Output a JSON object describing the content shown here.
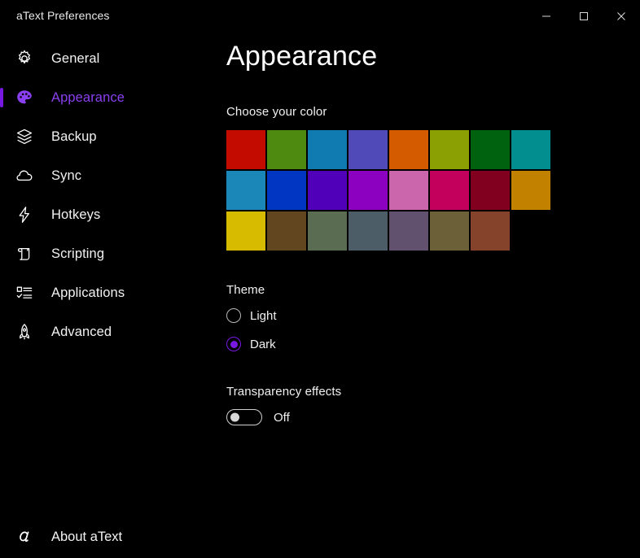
{
  "window": {
    "title": "aText Preferences",
    "controls": [
      {
        "name": "minimize",
        "label": "Minimize"
      },
      {
        "name": "maximize",
        "label": "Maximize"
      },
      {
        "name": "close",
        "label": "Close"
      }
    ]
  },
  "accent_color": "#7719e0",
  "sidebar": {
    "items": [
      {
        "label": "General",
        "icon": "gear-icon",
        "selected": false
      },
      {
        "label": "Appearance",
        "icon": "palette-icon",
        "selected": true
      },
      {
        "label": "Backup",
        "icon": "layers-icon",
        "selected": false
      },
      {
        "label": "Sync",
        "icon": "cloud-icon",
        "selected": false
      },
      {
        "label": "Hotkeys",
        "icon": "lightning-icon",
        "selected": false
      },
      {
        "label": "Scripting",
        "icon": "scroll-icon",
        "selected": false
      },
      {
        "label": "Applications",
        "icon": "checklist-icon",
        "selected": false
      },
      {
        "label": "Advanced",
        "icon": "rocket-icon",
        "selected": false
      }
    ],
    "about": {
      "label": "About aText",
      "icon": "atext-logo-icon"
    }
  },
  "main": {
    "page_title": "Appearance",
    "choose_color_label": "Choose your color",
    "colors": [
      "#c30b00",
      "#4f8a10",
      "#0f7bb0",
      "#5049b8",
      "#d45b00",
      "#8ba003",
      "#00620f",
      "#028e8e",
      "#1a87b8",
      "#0036c2",
      "#5100ba",
      "#8c00c0",
      "#cb66ad",
      "#c4005d",
      "#81001f",
      "#c28200",
      "#d7bb00",
      "#62461f",
      "#5a6d53",
      "#4d5d68",
      "#61506e",
      "#6b6037",
      "#84432a"
    ],
    "theme_label": "Theme",
    "theme_options": [
      {
        "label": "Light",
        "checked": false
      },
      {
        "label": "Dark",
        "checked": true
      }
    ],
    "transparency_label": "Transparency effects",
    "transparency_state": "Off",
    "transparency_on": false
  }
}
